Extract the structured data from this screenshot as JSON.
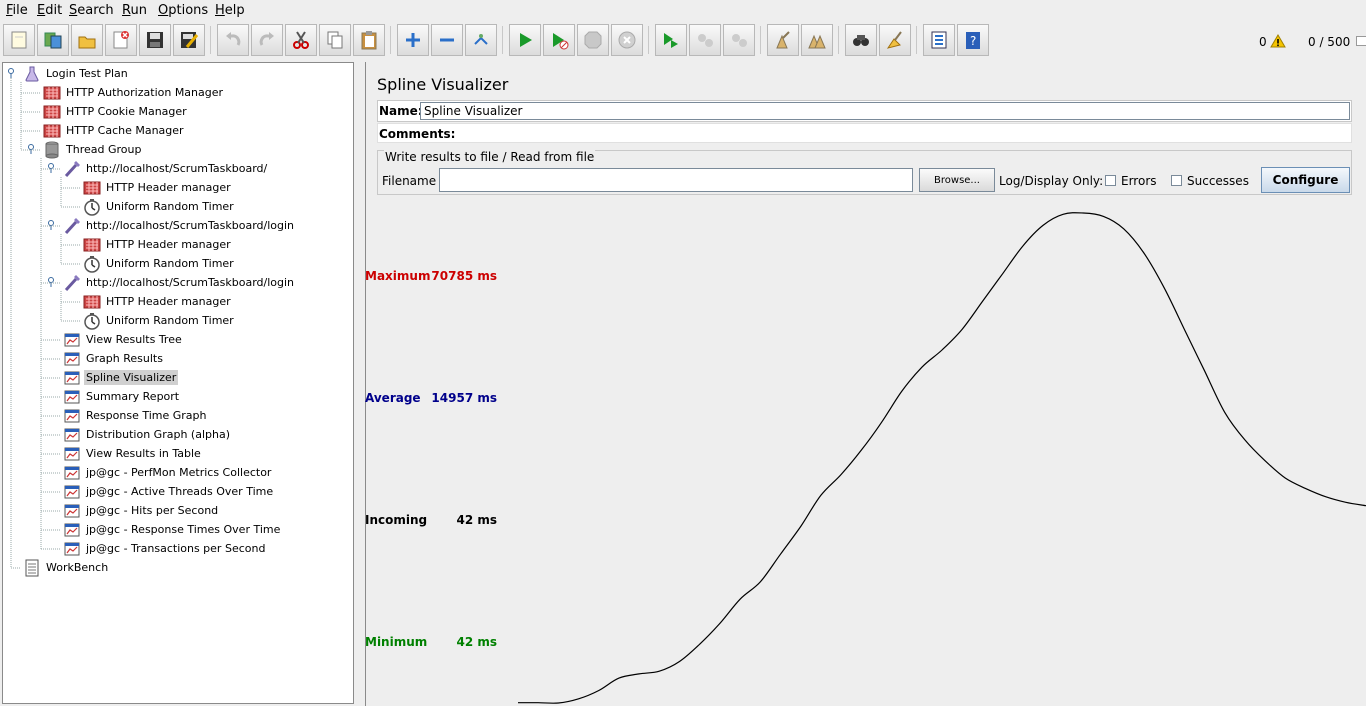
{
  "menu": [
    "File",
    "Edit",
    "Search",
    "Run",
    "Options",
    "Help"
  ],
  "toolbar": {
    "buttons": [
      "new-icon",
      "templates-icon",
      "open-icon",
      "close-icon",
      "save-icon",
      "save-as-icon",
      "undo-icon",
      "redo-icon",
      "cut-icon",
      "copy-icon",
      "paste-icon",
      "expand-icon",
      "collapse-icon",
      "toggle-icon",
      "start-icon",
      "start-no-timers-icon",
      "stop-icon",
      "shutdown-icon",
      "remote-start-icon",
      "remote-stop-icon",
      "remote-exit-icon",
      "clear-icon",
      "clear-all-icon",
      "search-icon",
      "reset-search-icon",
      "function-helper-icon",
      "help-icon"
    ],
    "error_count": "0",
    "threads": "0 / 500"
  },
  "tree": {
    "items": [
      {
        "label": "Login Test Plan",
        "icon": "test-plan-icon"
      },
      {
        "label": "HTTP Authorization Manager",
        "icon": "config-element-icon"
      },
      {
        "label": "HTTP Cookie Manager",
        "icon": "config-element-icon"
      },
      {
        "label": "HTTP Cache Manager",
        "icon": "config-element-icon"
      },
      {
        "label": "Thread Group",
        "icon": "thread-group-icon"
      },
      {
        "label": "http://localhost/ScrumTaskboard/",
        "icon": "sampler-icon"
      },
      {
        "label": "HTTP Header manager",
        "icon": "config-element-icon"
      },
      {
        "label": "Uniform Random Timer",
        "icon": "timer-icon"
      },
      {
        "label": "http://localhost/ScrumTaskboard/login",
        "icon": "sampler-icon"
      },
      {
        "label": "HTTP Header manager",
        "icon": "config-element-icon"
      },
      {
        "label": "Uniform Random Timer",
        "icon": "timer-icon"
      },
      {
        "label": "http://localhost/ScrumTaskboard/login",
        "icon": "sampler-icon"
      },
      {
        "label": "HTTP Header manager",
        "icon": "config-element-icon"
      },
      {
        "label": "Uniform Random Timer",
        "icon": "timer-icon"
      },
      {
        "label": "View Results Tree",
        "icon": "listener-icon"
      },
      {
        "label": "Graph Results",
        "icon": "listener-icon"
      },
      {
        "label": "Spline Visualizer",
        "icon": "listener-icon"
      },
      {
        "label": "Summary Report",
        "icon": "listener-icon"
      },
      {
        "label": "Response Time Graph",
        "icon": "listener-icon"
      },
      {
        "label": "Distribution Graph (alpha)",
        "icon": "listener-icon"
      },
      {
        "label": "View Results in Table",
        "icon": "listener-icon"
      },
      {
        "label": "jp@gc - PerfMon Metrics Collector",
        "icon": "listener-icon"
      },
      {
        "label": "jp@gc - Active Threads Over Time",
        "icon": "listener-icon"
      },
      {
        "label": "jp@gc - Hits per Second",
        "icon": "listener-icon"
      },
      {
        "label": "jp@gc - Response Times Over Time",
        "icon": "listener-icon"
      },
      {
        "label": "jp@gc - Transactions per Second",
        "icon": "listener-icon"
      },
      {
        "label": "WorkBench",
        "icon": "workbench-icon"
      }
    ],
    "selected_label": "Spline Visualizer"
  },
  "panel": {
    "title": "Spline Visualizer",
    "name_label": "Name:",
    "name_value": "Spline Visualizer",
    "comments_label": "Comments:",
    "file_section_title": "Write results to file / Read from file",
    "filename_label": "Filename",
    "filename_value": "",
    "browse_label": "Browse...",
    "log_display_label": "Log/Display Only:",
    "errors_label": "Errors",
    "successes_label": "Successes",
    "configure_label": "Configure"
  },
  "stats": {
    "maximum": {
      "label": "Maximum",
      "value": "70785 ms",
      "color": "#cc0000"
    },
    "average": {
      "label": "Average",
      "value": "14957 ms",
      "color": "#00008b"
    },
    "incoming": {
      "label": "Incoming",
      "value": "42 ms",
      "color": "#000000"
    },
    "minimum": {
      "label": "Minimum",
      "value": "42 ms",
      "color": "#008000"
    }
  },
  "chart_data": {
    "type": "line",
    "title": "",
    "xlabel": "",
    "ylabel": "",
    "series": [
      {
        "x": [
          0,
          1,
          2,
          3,
          4,
          5,
          6,
          7,
          8,
          9,
          10,
          11,
          12,
          13,
          14,
          15,
          16,
          17,
          18,
          19,
          20,
          21,
          22,
          23,
          24,
          25,
          26,
          27,
          28,
          29,
          30,
          31,
          32,
          33,
          34,
          35,
          36,
          37,
          38,
          39,
          40,
          41,
          42
        ],
        "y": [
          40,
          42,
          0,
          600,
          1800,
          3600,
          4200,
          4600,
          6000,
          8500,
          11500,
          15000,
          17500,
          21500,
          25500,
          30000,
          33000,
          36500,
          40500,
          45000,
          48500,
          51000,
          54000,
          58000,
          62000,
          66000,
          69000,
          70600,
          70785,
          70300,
          68500,
          65000,
          60000,
          54000,
          48000,
          42000,
          38000,
          35000,
          32500,
          31000,
          29800,
          29000,
          28500
        ]
      }
    ],
    "ylim": [
      0,
      70785
    ]
  }
}
